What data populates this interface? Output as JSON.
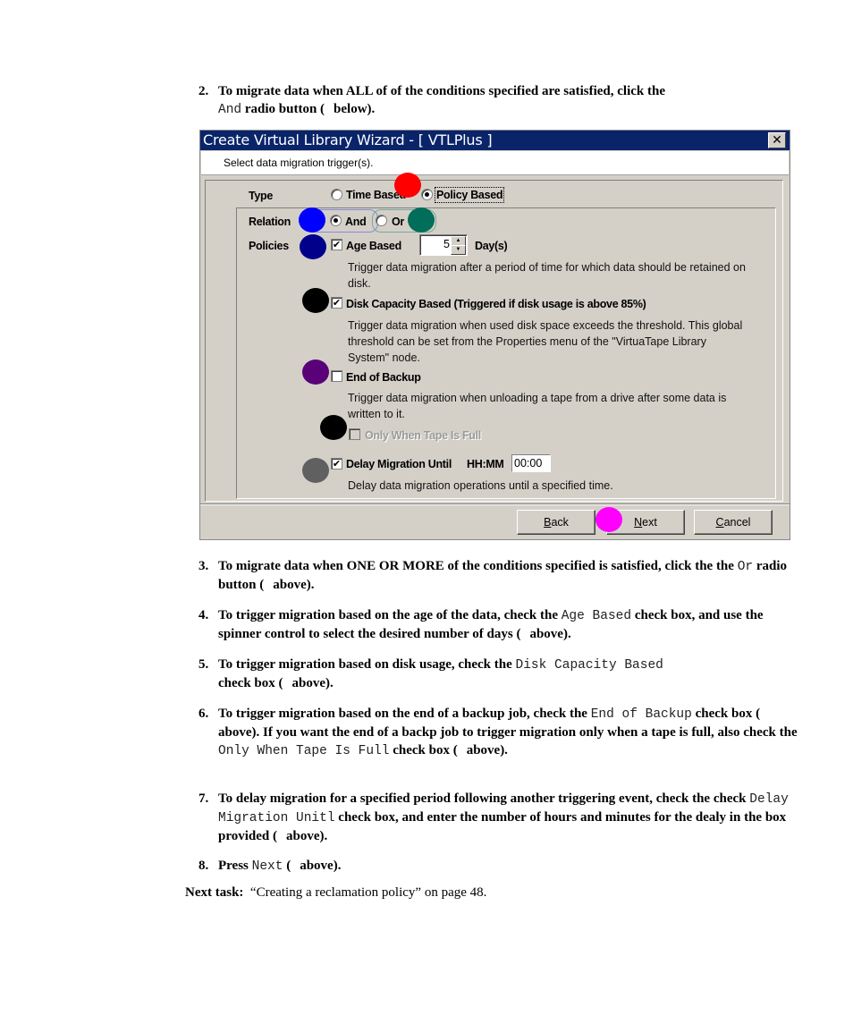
{
  "doc": {
    "step2": {
      "num": "2.",
      "pre": "To migrate data when ALL of of the conditions specified are satisfied, click the",
      "code": "And",
      "post": "radio button (",
      "ref": "below)."
    },
    "step3": {
      "num": "3.",
      "pre": "To migrate data when ONE OR MORE of the conditions specified is satisfied, click the the",
      "code": "Or",
      "post": "radio button (",
      "ref": "above)."
    },
    "step4": {
      "num": "4.",
      "pre": "To trigger migration based on the age of the data, check the",
      "code": "Age Based",
      "post": "check box, and use the spinner control to select the desired number of days (",
      "ref": "above)."
    },
    "step5": {
      "num": "5.",
      "pre": "To trigger migration based on disk usage, check the",
      "code": "Disk Capacity Based",
      "post": "check box (",
      "ref": "above)."
    },
    "step6": {
      "num": "6.",
      "pre": "To trigger migration based on the end of a backup job, check the",
      "code": "End of Backup",
      "mid": "check box (",
      "mid2": "above). If you want the end of a backp job to trigger migration only when a tape is full, also check the",
      "code2": "Only When Tape Is Full",
      "post": "check box (",
      "ref": "above)."
    },
    "step7": {
      "num": "7.",
      "pre": "To delay migration for a specified period following another triggering event, check the check",
      "code": "Delay Migration Unitl",
      "post": "check box, and enter the number of hours and minutes for the dealy in the box provided (",
      "ref": "above)."
    },
    "step8": {
      "num": "8.",
      "pre": "Press",
      "code": "Next",
      "post": "(",
      "ref": "above)."
    },
    "next_task": {
      "label": "Next task:",
      "text": "“Creating a reclamation policy” on page 48."
    }
  },
  "dialog": {
    "title": "Create Virtual Library Wizard - [ VTLPlus ]",
    "close_glyph": "✕",
    "subheader": "Select data migration trigger(s).",
    "type": {
      "label": "Type",
      "options": [
        {
          "label": "Time Based",
          "selected": false
        },
        {
          "label": "Policy Based",
          "selected": true
        }
      ]
    },
    "relation": {
      "label": "Relation",
      "options": [
        {
          "label": "And",
          "selected": true
        },
        {
          "label": "Or",
          "selected": false
        }
      ]
    },
    "policies": {
      "label": "Policies",
      "age_based": {
        "label": "Age Based",
        "checked": true,
        "value": "5",
        "unit": "Day(s)",
        "desc": "Trigger data migration after a period of time for which data should be retained on disk."
      },
      "disk_capacity": {
        "label": "Disk Capacity Based (Triggered if disk usage is above 85%)",
        "checked": true,
        "desc": "Trigger data migration when used disk space exceeds the threshold. This global threshold can be set from the Properties menu of the \"VirtuaTape Library System\" node."
      },
      "end_of_backup": {
        "label": "End of Backup",
        "checked": false,
        "desc": "Trigger data migration when unloading a tape from a drive after some data is written to it."
      },
      "only_when_full": {
        "label": "Only When Tape Is Full",
        "checked": false,
        "enabled": false
      },
      "delay": {
        "label": "Delay Migration Until",
        "format_label": "HH:MM",
        "value": "00:00",
        "checked": true,
        "desc": "Delay data migration operations until a specified time."
      }
    },
    "buttons": {
      "back": {
        "mnemonic": "B",
        "rest": "ack"
      },
      "next": {
        "mnemonic": "N",
        "rest": "ext"
      },
      "cancel": {
        "mnemonic": "C",
        "rest": "ancel"
      }
    },
    "check_glyph": "✔",
    "spin_up": "▲",
    "spin_down": "▼"
  },
  "markers": {
    "red": "#ff0000",
    "blue": "#0000ff",
    "teal": "#006e5a",
    "navy": "#00008b",
    "black": "#000000",
    "purple": "#5a0078",
    "gray": "#606060",
    "magenta": "#ff00ff"
  }
}
